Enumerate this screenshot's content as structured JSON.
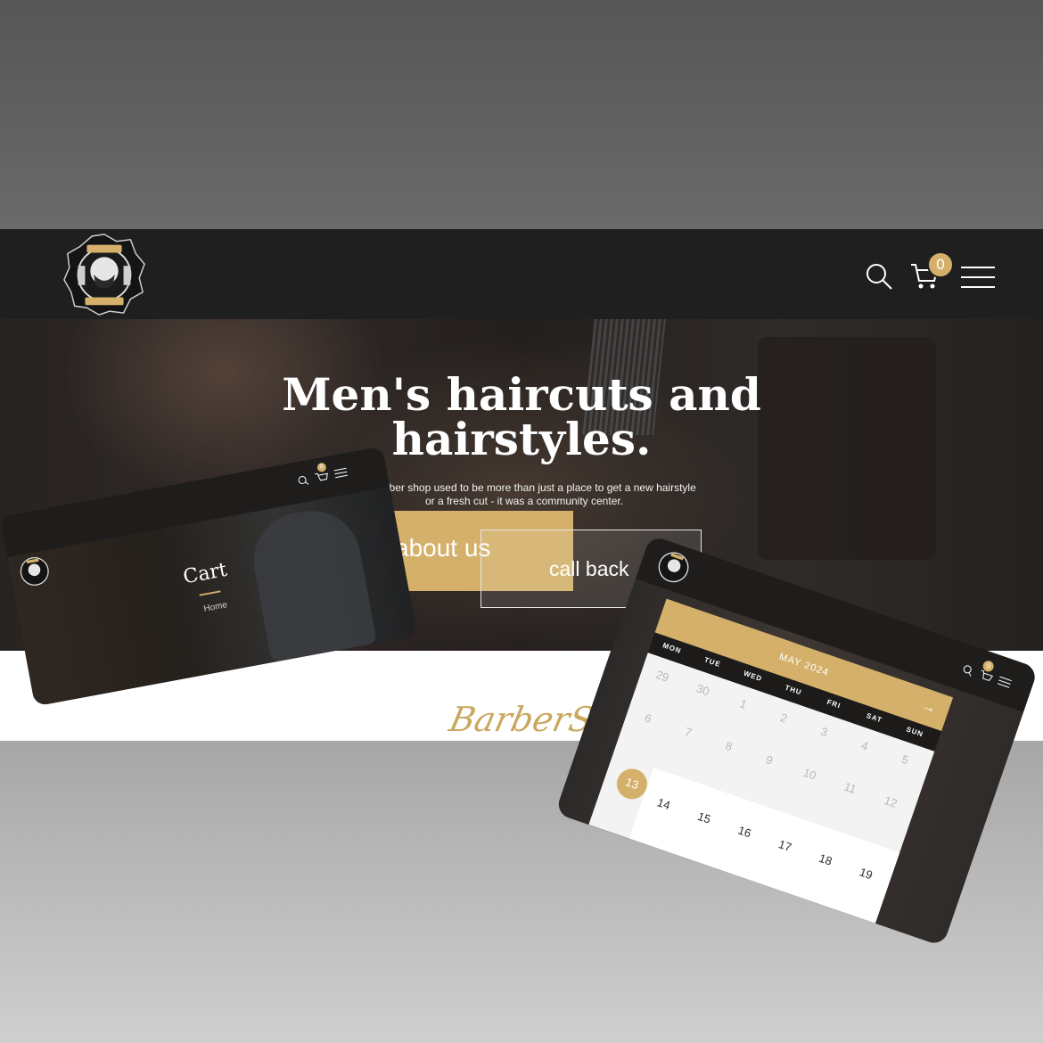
{
  "colors": {
    "accent": "#d4b06a",
    "navbar": "#201f1f",
    "white": "#ffffff"
  },
  "main_site": {
    "logo_icon": "barber-mustache-emblem",
    "nav": {
      "search_icon": "search-icon",
      "cart_icon": "cart-icon",
      "cart_count": "0",
      "menu_icon": "hamburger-menu-icon"
    },
    "hero": {
      "title": "Men's haircuts and hairstyles.",
      "subtitle": "The barber shop used to be more than just a place to get a new hairstyle or a fresh cut - it was a community center.",
      "about_button": "about us",
      "call_button": "call back"
    },
    "brand_script": "BarberShop"
  },
  "cart_mockup": {
    "title": "Cart",
    "breadcrumb": "Home",
    "cart_count": "0"
  },
  "calendar_mockup": {
    "month": "MAY 2024",
    "weekdays": [
      "MON",
      "TUE",
      "WED",
      "THU",
      "FRI",
      "SAT",
      "SUN"
    ],
    "weeks": [
      [
        "29",
        "30",
        "1",
        "2",
        "3",
        "4",
        "5"
      ],
      [
        "6",
        "7",
        "8",
        "9",
        "10",
        "11",
        "12"
      ],
      [
        "13",
        "14",
        "15",
        "16",
        "17",
        "18",
        "19"
      ]
    ],
    "today": "13",
    "cart_count": "0"
  }
}
